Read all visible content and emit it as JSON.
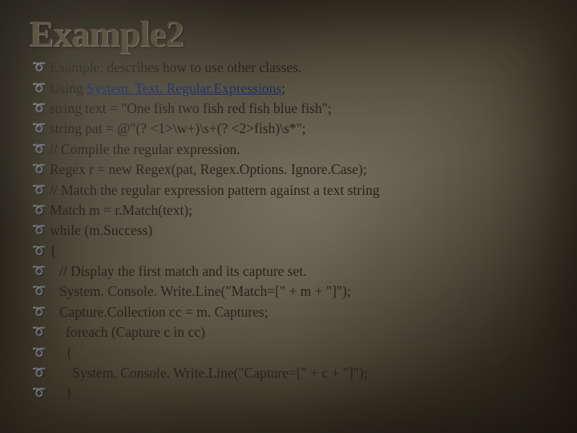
{
  "title": "Example2",
  "link_text": "System. Text. Regular.Expressions",
  "lines": [
    {
      "text": "Example: describes how to use other classes.",
      "indent": 0
    },
    {
      "text": "Using  {{LINK}};",
      "indent": 0
    },
    {
      "text": "string text = \"One fish two fish red fish blue fish\";",
      "indent": 0
    },
    {
      "text": "string pat = @\"(? <1>\\w+)\\s+(? <2>fish)\\s*\";",
      "indent": 0
    },
    {
      "text": "// Compile the regular expression.",
      "indent": 0
    },
    {
      "text": "Regex r = new Regex(pat, Regex.Options. Ignore.Case);",
      "indent": 0
    },
    {
      "text": "// Match the regular expression pattern against a text string",
      "indent": 0
    },
    {
      "text": "Match m = r.Match(text);",
      "indent": 0
    },
    {
      "text": "while (m.Success)",
      "indent": 0
    },
    {
      "text": "{",
      "indent": 0
    },
    {
      "text": "// Display the first match and its capture set.",
      "indent": 1
    },
    {
      "text": "System. Console. Write.Line(\"Match=[\" + m + \"]\");",
      "indent": 1
    },
    {
      "text": "Capture.Collection cc = m. Captures;",
      "indent": 1
    },
    {
      "text": "foreach (Capture c in cc)",
      "indent": 2
    },
    {
      "text": "{",
      "indent": 2
    },
    {
      "text": "System. Console. Write.Line(\"Capture=[\" + c + \"]\");",
      "indent": 3
    },
    {
      "text": "}",
      "indent": 2
    }
  ]
}
